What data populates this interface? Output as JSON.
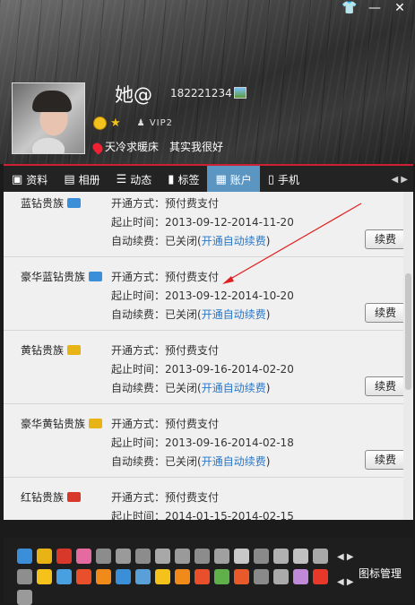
{
  "window": {
    "skin_icon": "shirt-icon",
    "min_label": "—",
    "close_label": "✕"
  },
  "profile": {
    "nickname": "她@",
    "qq_number": "182221234",
    "vip_label": "VIP2",
    "location": "天冷求暖床",
    "signature": "其实我很好"
  },
  "tabs": [
    {
      "label": "资料",
      "icon": "profile-icon"
    },
    {
      "label": "相册",
      "icon": "album-icon"
    },
    {
      "label": "动态",
      "icon": "feed-icon"
    },
    {
      "label": "标签",
      "icon": "bookmark-icon"
    },
    {
      "label": "账户",
      "icon": "wallet-icon",
      "active": true
    },
    {
      "label": "手机",
      "icon": "phone-icon"
    }
  ],
  "tab_scroll": "◀ ▶",
  "labels": {
    "method_prefix": "开通方式：",
    "period_prefix": "起止时间：",
    "auto_prefix": "自动续费：",
    "renew_button": "续费"
  },
  "entries": [
    {
      "name": "蓝钻贵族",
      "method": "预付费支付",
      "period": "2013-09-12-2014-11-20",
      "auto_status": "已关闭",
      "auto_link": "开通自动续费",
      "color": "#3a8fd8"
    },
    {
      "name": "豪华蓝钻贵族",
      "method": "预付费支付",
      "period": "2013-09-12-2014-10-20",
      "auto_status": "已关闭",
      "auto_link": "开通自动续费",
      "color": "#3a8fd8"
    },
    {
      "name": "黄钻贵族",
      "method": "预付费支付",
      "period": "2013-09-16-2014-02-20",
      "auto_status": "已关闭",
      "auto_link": "开通自动续费",
      "color": "#e8b315"
    },
    {
      "name": "豪华黄钻贵族",
      "method": "预付费支付",
      "period": "2013-09-16-2014-02-18",
      "auto_status": "已关闭",
      "auto_link": "开通自动续费",
      "color": "#e8b315"
    },
    {
      "name": "红钻贵族",
      "method": "预付费支付",
      "period": "2014-01-15-2014-02-15",
      "auto_status": "",
      "auto_link": "",
      "color": "#d8382a"
    }
  ],
  "bottom": {
    "manage_label": "图标管理",
    "nav_arrows": "◀ ▶",
    "icon_colors_row1": [
      "#3a8fd8",
      "#e8b315",
      "#d8382a",
      "#e56aa0",
      "#8c8c8c",
      "#9a9a9a",
      "#8c8c8c",
      "#a8a8a8",
      "#9a9a9a",
      "#8c8c8c",
      "#a0a0a0",
      "#c8c8c8",
      "#8a8a8a",
      "#b0b0b0",
      "#c0c0c0",
      "#a8a8a8",
      "#8e8e8e"
    ],
    "icon_colors_row2": [
      "#f4c21a",
      "#49a0e0",
      "#e84f2a",
      "#f08a1a",
      "#3a8fd8",
      "#5aa0d8",
      "#f4c21a",
      "#f08a1a",
      "#e84f2a",
      "#5fb04a",
      "#e85a2a",
      "#8a8a8a",
      "#aaaaaa",
      "#c08ad8",
      "#e8382a",
      "#9a9a9a"
    ]
  }
}
